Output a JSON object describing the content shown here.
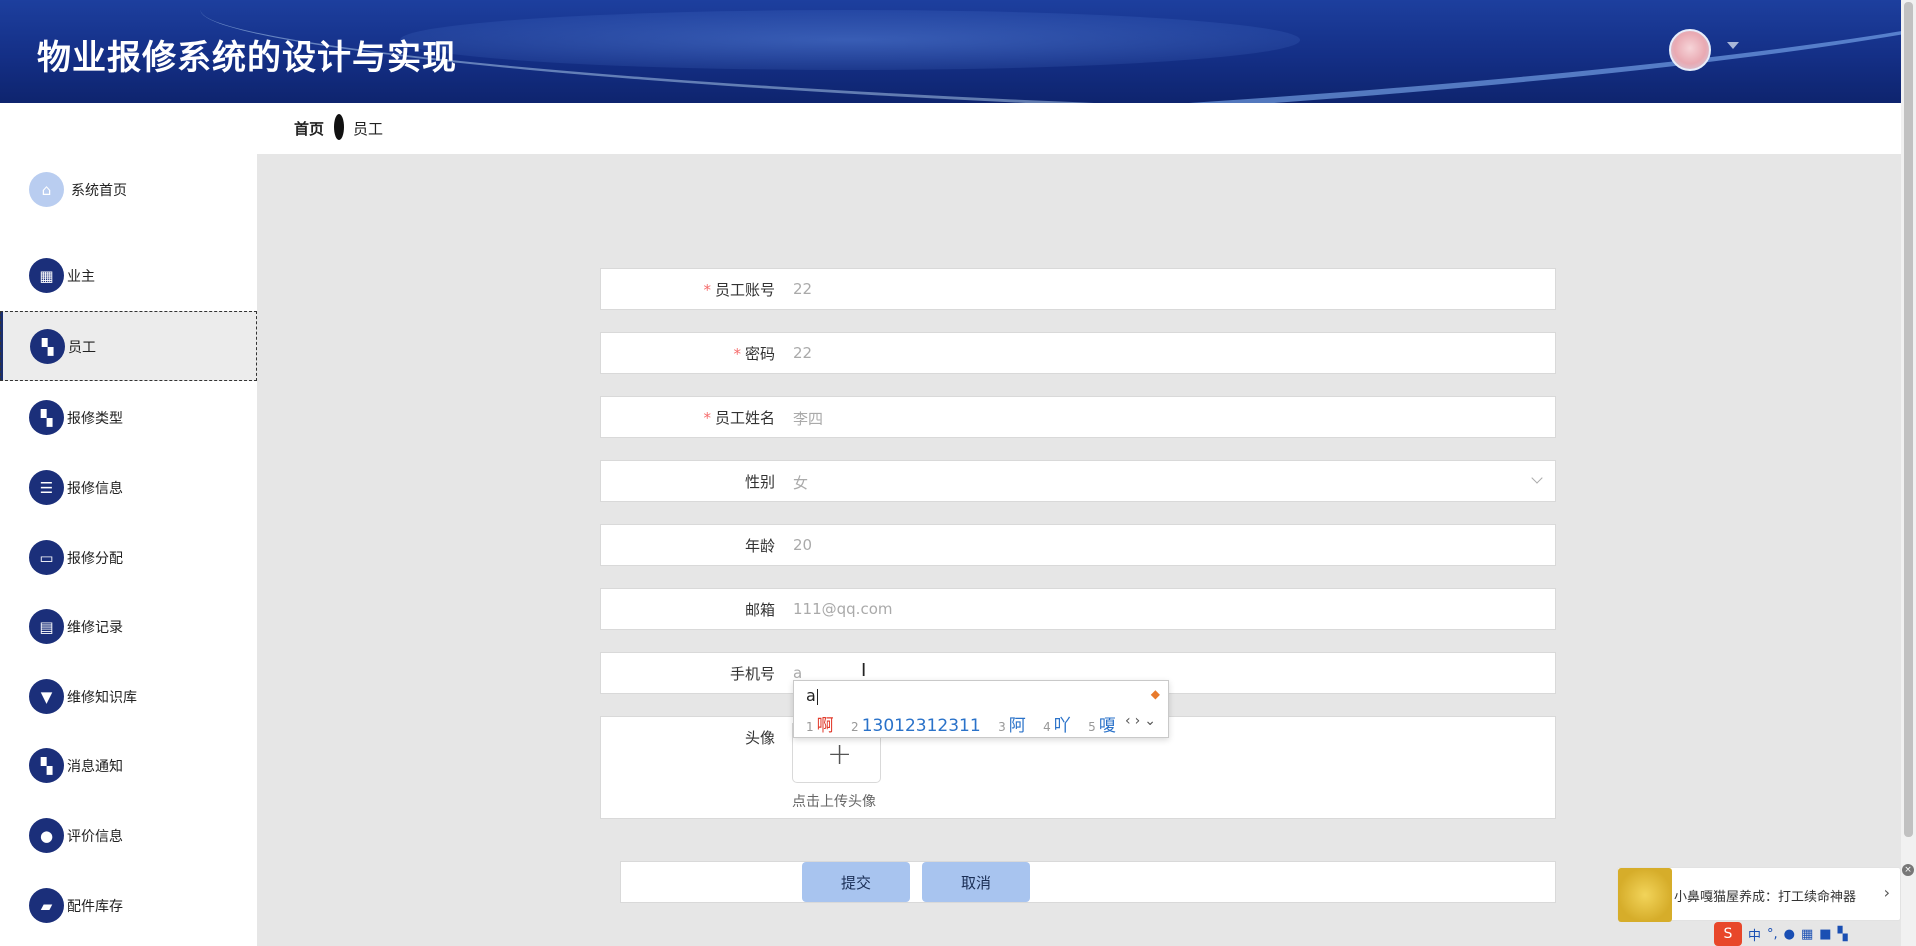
{
  "header": {
    "title": "物业报修系统的设计与实现"
  },
  "breadcrumb": {
    "home": "首页",
    "current": "员工"
  },
  "sidebar": {
    "items": [
      {
        "label": "系统首页",
        "icon": "home-icon"
      },
      {
        "label": "业主",
        "icon": "grid-icon"
      },
      {
        "label": "员工",
        "icon": "apps-icon"
      },
      {
        "label": "报修类型",
        "icon": "apps-icon"
      },
      {
        "label": "报修信息",
        "icon": "list-icon"
      },
      {
        "label": "报修分配",
        "icon": "monitor-icon"
      },
      {
        "label": "维修记录",
        "icon": "clipboard-icon"
      },
      {
        "label": "维修知识库",
        "icon": "brush-icon"
      },
      {
        "label": "消息通知",
        "icon": "apps-icon"
      },
      {
        "label": "评价信息",
        "icon": "bulb-icon"
      },
      {
        "label": "配件库存",
        "icon": "wallet-icon"
      }
    ]
  },
  "form": {
    "account": {
      "label": "员工账号",
      "value": "22"
    },
    "password": {
      "label": "密码",
      "value": "22"
    },
    "name": {
      "label": "员工姓名",
      "value": "李四"
    },
    "gender": {
      "label": "性别",
      "value": "女"
    },
    "age": {
      "label": "年龄",
      "value": "20"
    },
    "email": {
      "label": "邮箱",
      "value": "111@qq.com"
    },
    "phone": {
      "label": "手机号",
      "value": "a"
    },
    "avatar": {
      "label": "头像",
      "hint": "点击上传头像"
    },
    "submit_label": "提交",
    "cancel_label": "取消"
  },
  "ime": {
    "input": "a",
    "candidates": [
      {
        "n": "1",
        "text": "啊"
      },
      {
        "n": "2",
        "text": "13012312311"
      },
      {
        "n": "3",
        "text": "阿"
      },
      {
        "n": "4",
        "text": "吖"
      },
      {
        "n": "5",
        "text": "嗄"
      }
    ]
  },
  "ad": {
    "text": "小鼻嘎猫屋养成：打工续命神器"
  },
  "tray": {
    "lang": "中"
  },
  "colors": {
    "header_bg": "#142f86",
    "menu_icon_bg": "#1b2f7a",
    "button_bg": "#a8c4ef",
    "required": "#f56c6c"
  }
}
